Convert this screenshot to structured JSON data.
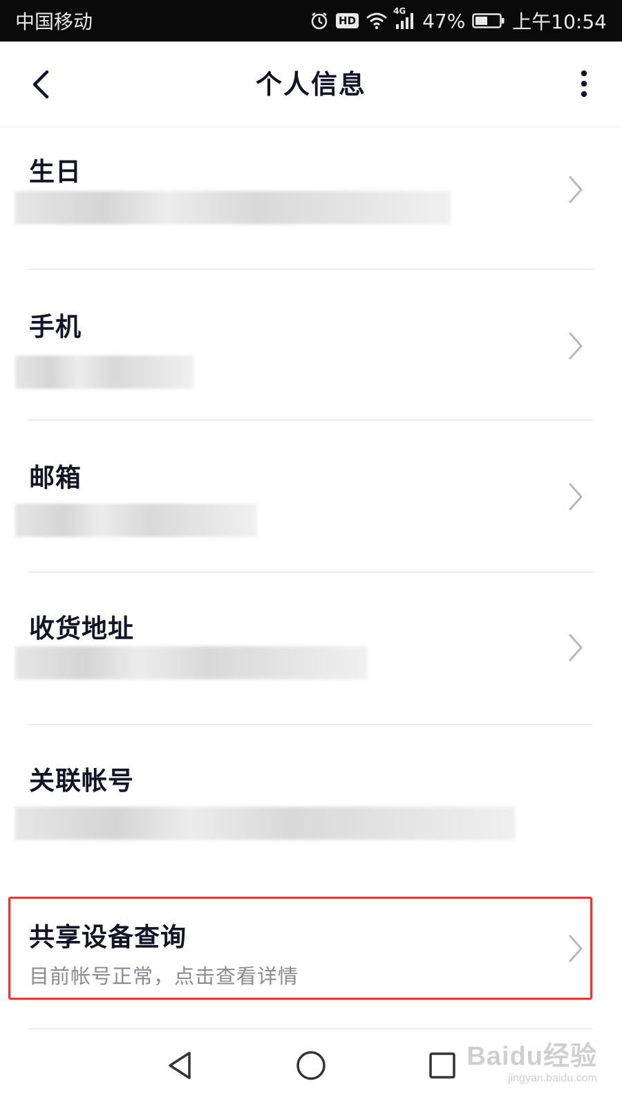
{
  "status_bar": {
    "carrier": "中国移动",
    "network": "4G",
    "battery": "47%",
    "time": "上午10:54",
    "icons": [
      "alarm-icon",
      "hd-icon",
      "wifi-icon",
      "signal-icon",
      "battery-icon"
    ],
    "hd_label": "HD"
  },
  "header": {
    "title": "个人信息",
    "back_icon": "chevron-left-icon",
    "more_icon": "more-vertical-icon"
  },
  "rows": [
    {
      "label": "生日"
    },
    {
      "label": "手机"
    },
    {
      "label": "邮箱"
    },
    {
      "label": "收货地址"
    },
    {
      "label": "关联帐号"
    },
    {
      "label": "共享设备查询",
      "subtitle": "目前帐号正常，点击查看详情",
      "highlighted": true
    }
  ],
  "nav_bar": {
    "icons": [
      "back-triangle-icon",
      "home-circle-icon",
      "recents-square-icon"
    ]
  },
  "watermark": {
    "brand": "Baidu经验",
    "url": "jingyan.baidu.com"
  },
  "colors": {
    "highlight_border": "#e53935",
    "title_text": "#141428",
    "subtitle_text": "#8a8a94"
  }
}
